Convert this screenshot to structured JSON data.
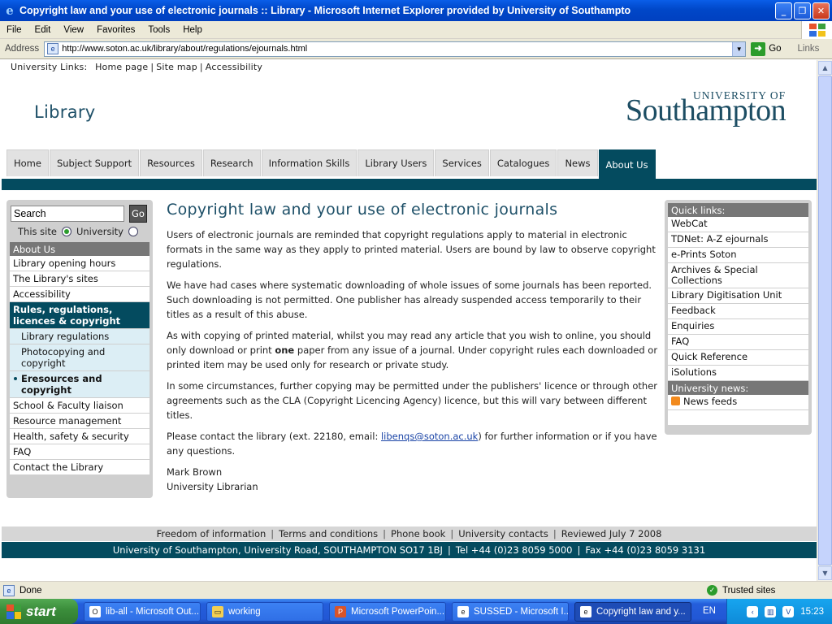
{
  "window": {
    "title": "Copyright law and your use of electronic journals :: Library - Microsoft Internet Explorer provided by University of Southampto"
  },
  "menubar": {
    "items": [
      "File",
      "Edit",
      "View",
      "Favorites",
      "Tools",
      "Help"
    ]
  },
  "addressbar": {
    "label": "Address",
    "url": "http://www.soton.ac.uk/library/about/regulations/ejournals.html",
    "go_label": "Go",
    "links_label": "Links"
  },
  "page": {
    "university_links_label": "University Links:",
    "university_links": [
      "Home page",
      "Site map",
      "Accessibility"
    ],
    "site_title": "Library",
    "logo": {
      "line1": "UNIVERSITY OF",
      "line2": "Southampton"
    },
    "tabs": [
      "Home",
      "Subject Support",
      "Resources",
      "Research",
      "Information Skills",
      "Library Users",
      "Services",
      "Catalogues",
      "News",
      "About Us"
    ],
    "search": {
      "placeholder": "Search",
      "go_label": "Go",
      "scope_this_site": "This site",
      "scope_university": "University"
    },
    "left_nav": {
      "heading": "About Us",
      "items": [
        "Library opening hours",
        "The Library's sites",
        "Accessibility",
        "Rules, regulations, licences & copyright",
        "Library regulations",
        "Photocopying and copyright",
        "Eresources and copyright",
        "School & Faculty liaison",
        "Resource management",
        "Health, safety & security",
        "FAQ",
        "Contact the Library"
      ]
    },
    "content": {
      "heading": "Copyright law and your use of electronic journals",
      "p1": "Users of electronic journals are reminded that copyright regulations apply to material in electronic formats in the same way as they apply to printed material. Users are bound by law to observe copyright regulations.",
      "p2": "We have had cases where systematic downloading of whole issues of some journals has been reported. Such downloading is not permitted. One publisher has already suspended access temporarily to their titles as a result of this abuse.",
      "p3_a": "As with copying of printed material, whilst you may read any article that you wish to online, you should only download or print ",
      "p3_b": "one",
      "p3_c": " paper from any issue of a journal. Under copyright rules each downloaded or printed item may be used only for research or private study.",
      "p4": "In some circumstances, further copying may be permitted under the publishers' licence or through other agreements such as the CLA (Copyright Licencing Agency) licence, but this will vary between different titles.",
      "p5_a": "Please contact the library (ext. 22180, email: ",
      "p5_link": "libenqs@soton.ac.uk",
      "p5_b": ") for further information or if you have any questions.",
      "signoff_name": "Mark Brown",
      "signoff_title": "University Librarian"
    },
    "quick_links": {
      "heading": "Quick links:",
      "items": [
        "WebCat",
        "TDNet: A-Z ejournals",
        "e-Prints Soton",
        "Archives & Special Collections",
        "Library Digitisation Unit",
        "Feedback",
        "Enquiries",
        "FAQ",
        "Quick Reference",
        "iSolutions"
      ],
      "news_heading": "University news:",
      "news_item": "News feeds"
    },
    "footer": {
      "links": [
        "Freedom of information",
        "Terms and conditions",
        "Phone book",
        "University contacts",
        "Reviewed July 7 2008"
      ],
      "address": [
        "University of Southampton, University Road, SOUTHAMPTON SO17 1BJ",
        "Tel +44 (0)23 8059 5000",
        "Fax +44 (0)23 8059 3131"
      ]
    }
  },
  "statusbar": {
    "status": "Done",
    "zone": "Trusted sites"
  },
  "taskbar": {
    "start_label": "start",
    "buttons": [
      "lib-all - Microsoft Out...",
      "working",
      "Microsoft PowerPoin...",
      "SUSSED - Microsoft I...",
      "Copyright law and y..."
    ],
    "lang": "EN",
    "clock": "15:23"
  }
}
